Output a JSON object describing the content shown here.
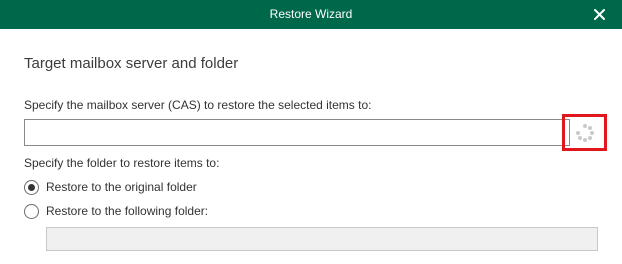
{
  "window": {
    "title": "Restore Wizard",
    "close_icon": "close-icon",
    "titlebar_color": "#00684a"
  },
  "page": {
    "heading": "Target mailbox server and folder"
  },
  "server": {
    "label": "Specify the mailbox server (CAS) to restore the selected items to:",
    "value": "",
    "loading_icon": "loading-spinner-icon",
    "highlight_color": "#e0171c"
  },
  "folder": {
    "label": "Specify the folder to restore items to:",
    "options": [
      {
        "label": "Restore to the original folder",
        "checked": true
      },
      {
        "label": "Restore to the following folder:",
        "checked": false
      }
    ],
    "path_value": ""
  }
}
